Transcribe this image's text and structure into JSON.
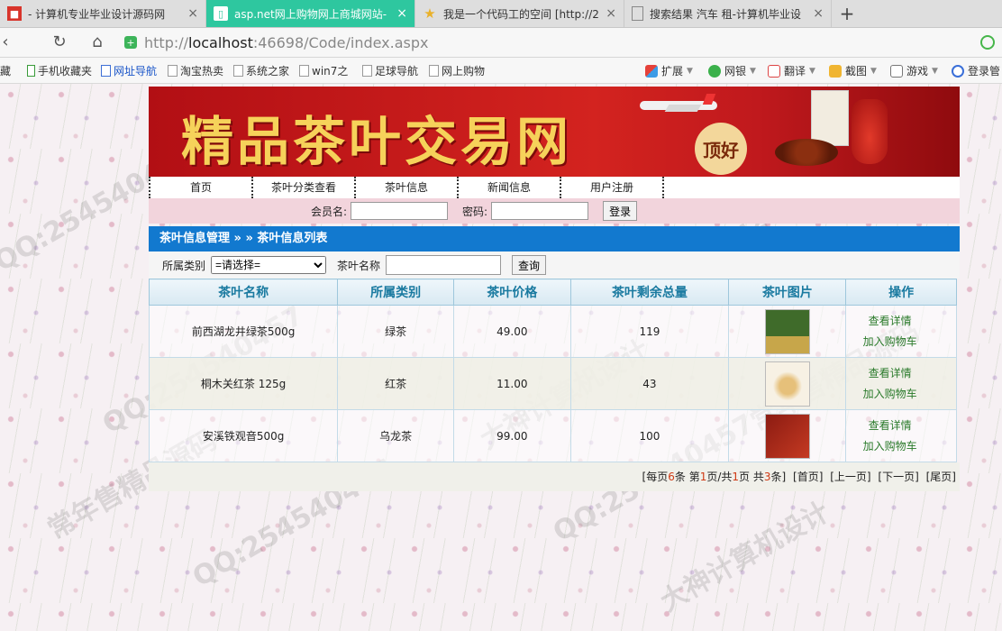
{
  "browser": {
    "tabs": [
      {
        "title": "- 计算机专业毕业设计源码网",
        "active": false
      },
      {
        "title": "asp.net网上购物网上商城网站-",
        "active": true
      },
      {
        "title": "我是一个代码工的空间 [http://2",
        "active": false
      },
      {
        "title": "搜索结果 汽车 租-计算机毕业设",
        "active": false
      }
    ],
    "url_prefix": "http://",
    "url_host": "localhost",
    "url_path": ":46698/Code/index.aspx",
    "bookmarks": [
      {
        "label": "藏"
      },
      {
        "label": "手机收藏夹"
      },
      {
        "label": "网址导航"
      },
      {
        "label": "淘宝热卖"
      },
      {
        "label": "系统之家"
      },
      {
        "label": "win7之"
      },
      {
        "label": "足球导航"
      },
      {
        "label": "网上购物"
      }
    ],
    "extensions": [
      {
        "label": "扩展"
      },
      {
        "label": "网银"
      },
      {
        "label": "翻译"
      },
      {
        "label": "截图"
      },
      {
        "label": "游戏"
      },
      {
        "label": "登录管"
      }
    ]
  },
  "site": {
    "banner_title": "精品茶叶交易网",
    "banner_badge": "顶好",
    "menu": [
      "首页",
      "茶叶分类查看",
      "茶叶信息",
      "新闻信息",
      "用户注册"
    ],
    "login": {
      "member_label": "会员名:",
      "password_label": "密码:",
      "login_button": "登录"
    },
    "section_title": "茶叶信息管理 » » 茶叶信息列表",
    "search": {
      "category_label": "所属类别",
      "category_selected": "=请选择=",
      "name_label": "茶叶名称",
      "query_button": "查询"
    },
    "table": {
      "headers": [
        "茶叶名称",
        "所属类别",
        "茶叶价格",
        "茶叶剩余总量",
        "茶叶图片",
        "操作"
      ],
      "rows": [
        {
          "name": "前西湖龙井绿茶500g",
          "category": "绿茶",
          "price": "49.00",
          "stock": "119",
          "detail": "查看详情",
          "cart": "加入购物车"
        },
        {
          "name": "桐木关红茶 125g",
          "category": "红茶",
          "price": "11.00",
          "stock": "43",
          "detail": "查看详情",
          "cart": "加入购物车"
        },
        {
          "name": "安溪铁观音500g",
          "category": "乌龙茶",
          "price": "99.00",
          "stock": "100",
          "detail": "查看详情",
          "cart": "加入购物车"
        }
      ]
    },
    "pager": {
      "t1": "[每页",
      "per_page": "6",
      "t2": "条 第",
      "current": "1",
      "t3": "页/共",
      "total_pages": "1",
      "t4": "页 共",
      "total_items": "3",
      "t5": "条]",
      "first": "[首页]",
      "prev": "[上一页]",
      "next": "[下一页]",
      "last": "[尾页]"
    },
    "watermark_qq": "QQ:254540457",
    "watermark_a": "常年售精品源码",
    "watermark_b": "大神计算机设计"
  },
  "colors": {
    "active_tab": "#2ec79f",
    "section_head": "#1279cf",
    "banner_red": "#c0191d",
    "link_green": "#2a7a2a"
  }
}
